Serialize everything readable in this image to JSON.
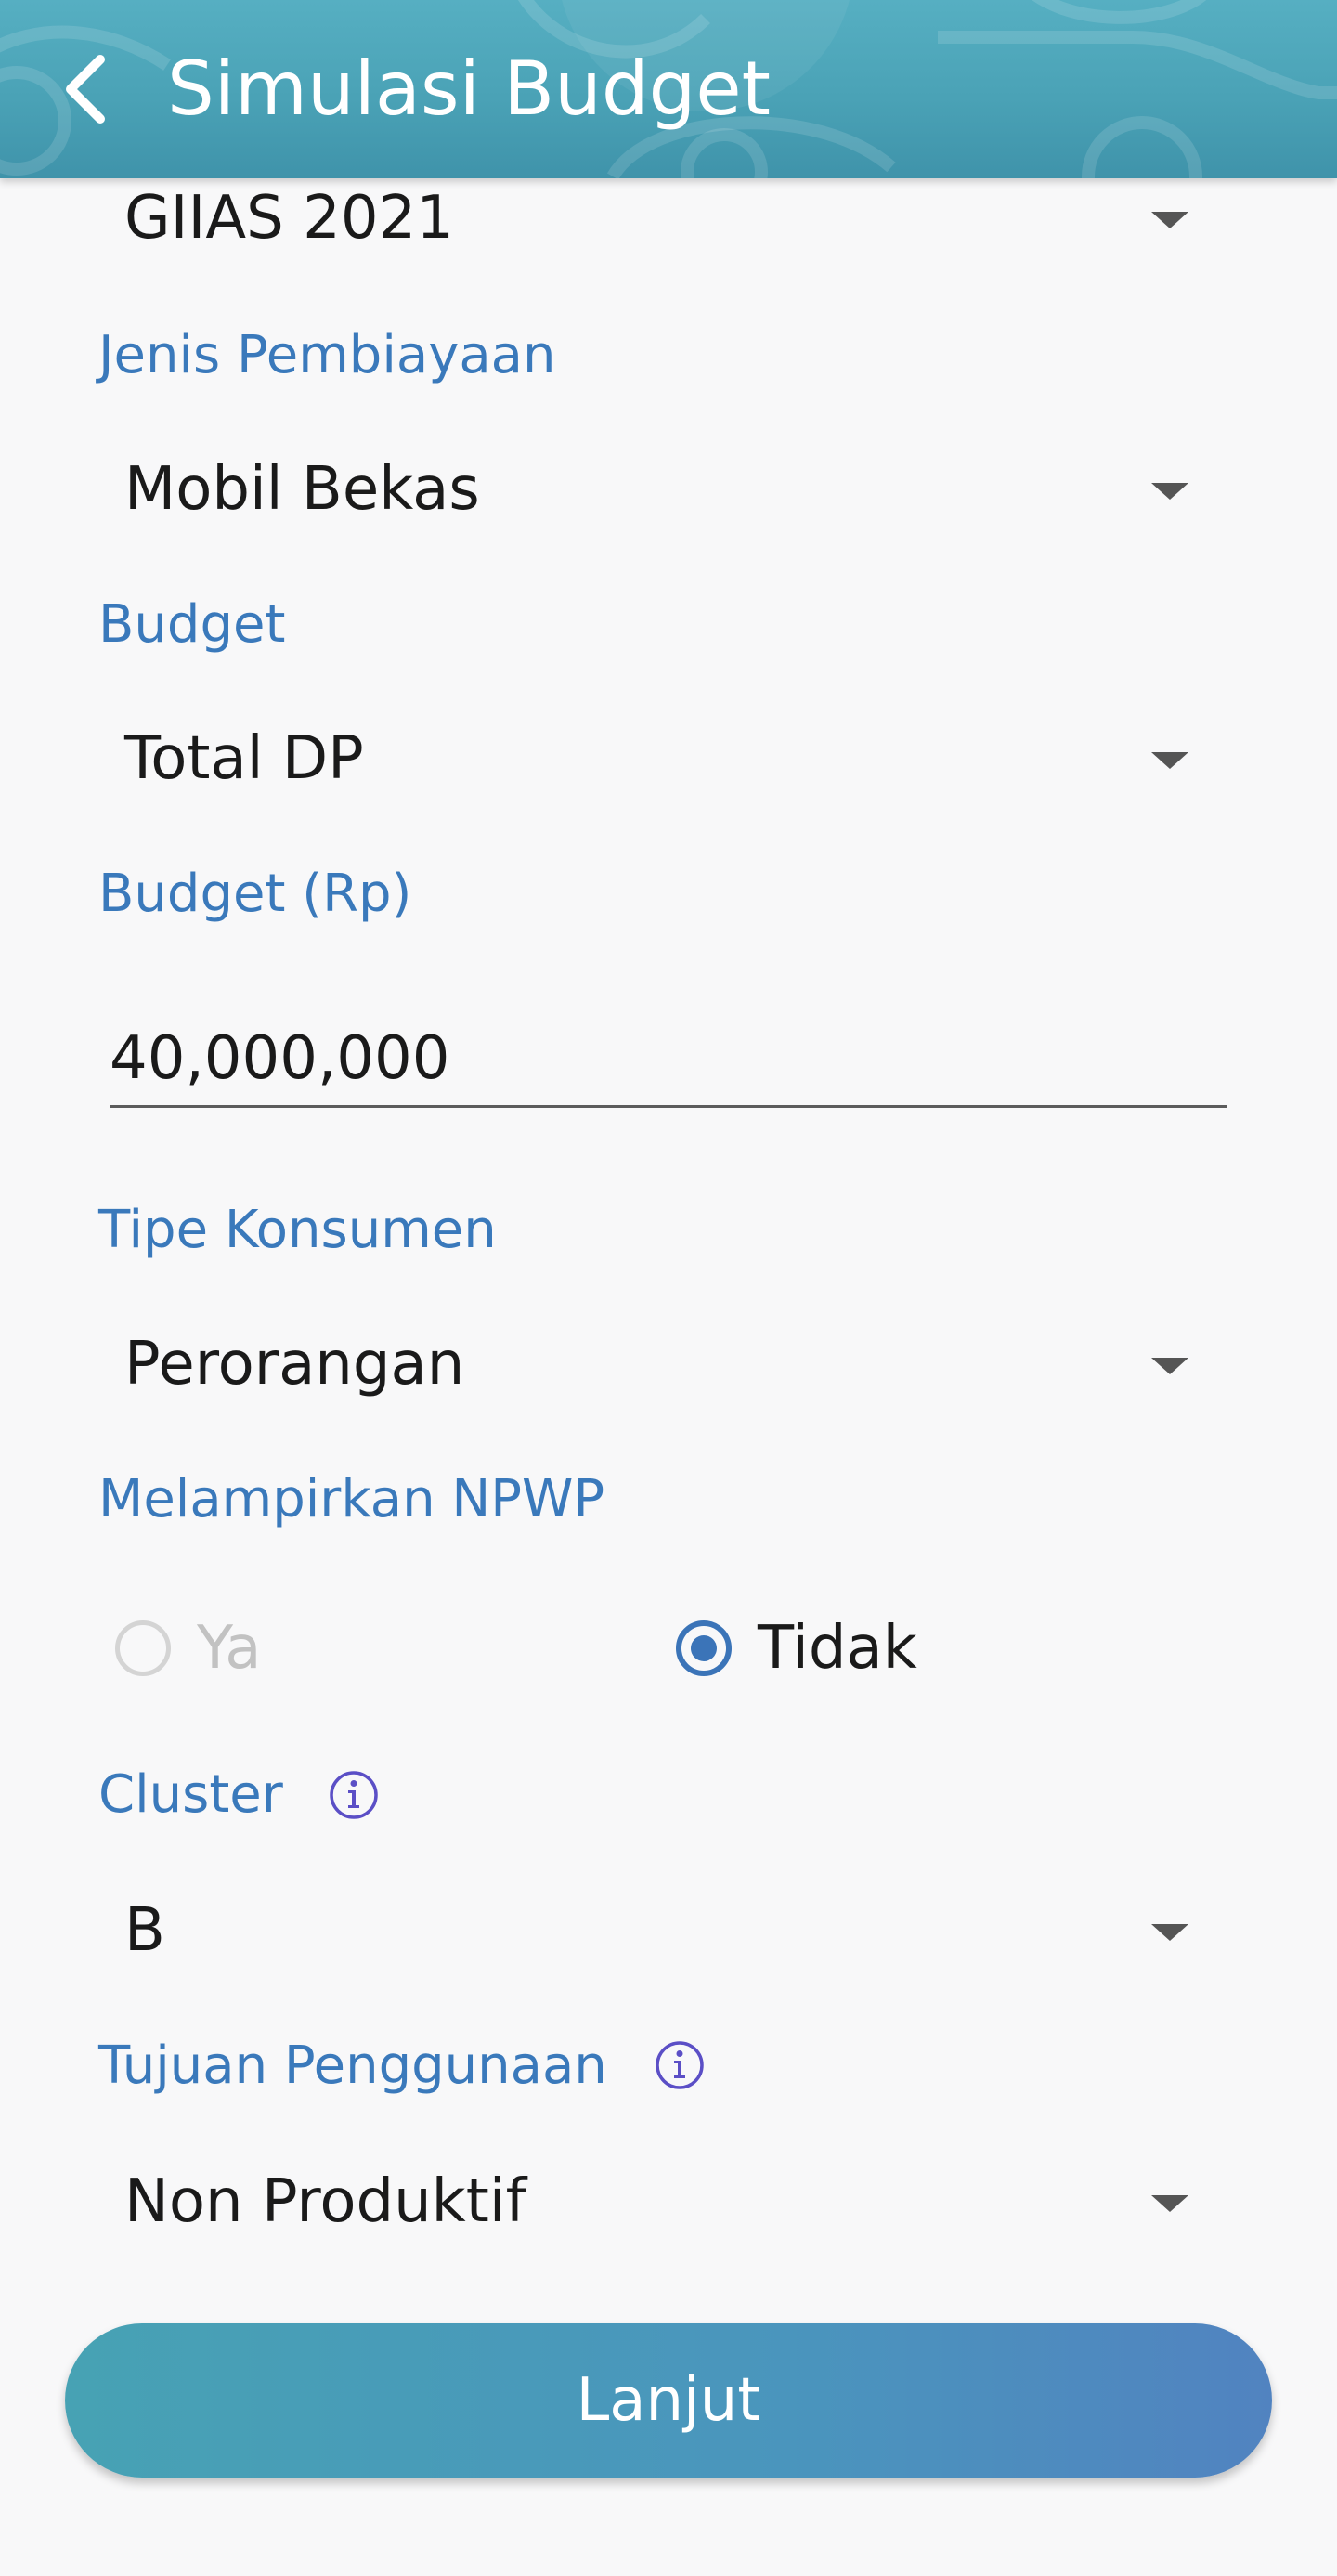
{
  "header": {
    "title": "Simulasi Budget",
    "back_icon": "chevron-left-icon"
  },
  "form": {
    "event": {
      "value": "GIIAS 2021"
    },
    "jenis_pembiayaan": {
      "label": "Jenis Pembiayaan",
      "value": "Mobil Bekas"
    },
    "budget_type": {
      "label": "Budget",
      "value": "Total DP"
    },
    "budget_amount": {
      "label": "Budget (Rp)",
      "value": "40,000,000"
    },
    "tipe_konsumen": {
      "label": "Tipe Konsumen",
      "value": "Perorangan"
    },
    "npwp": {
      "label": "Melampirkan NPWP",
      "options": [
        {
          "label": "Ya",
          "selected": false,
          "enabled": false
        },
        {
          "label": "Tidak",
          "selected": true,
          "enabled": true
        }
      ]
    },
    "cluster": {
      "label": "Cluster",
      "value": "B"
    },
    "tujuan_penggunaan": {
      "label": "Tujuan Penggunaan",
      "value": "Non Produktif"
    }
  },
  "actions": {
    "submit_label": "Lanjut"
  },
  "colors": {
    "header_bg": "#4aa2b6",
    "label": "#3a79bb",
    "radio_selected": "#3b74b8",
    "info_icon": "#5b4fc6",
    "button_start": "#47a2b4",
    "button_end": "#5183c0"
  }
}
